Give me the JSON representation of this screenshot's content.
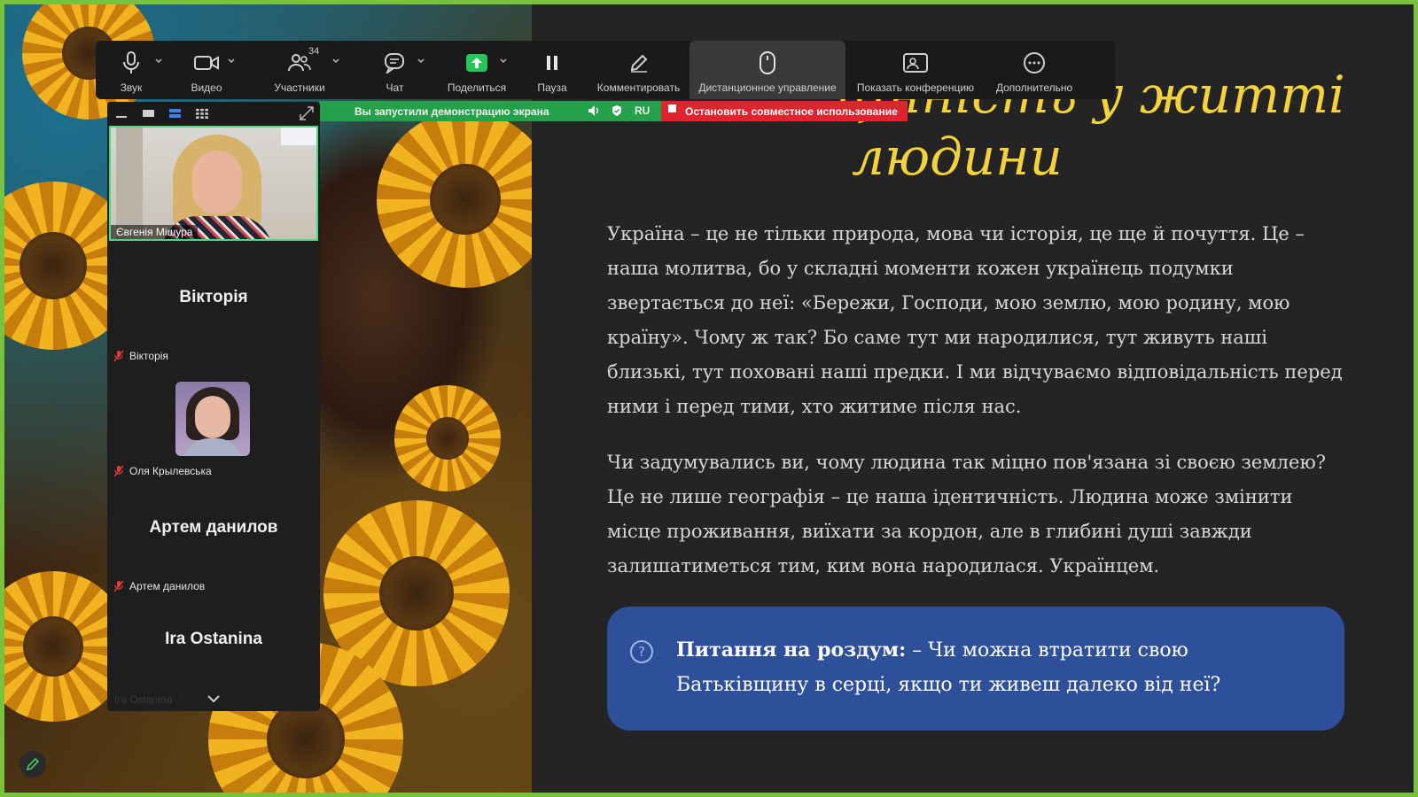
{
  "toolbar": {
    "items": [
      {
        "label": "Звук",
        "icon": "microphone-icon"
      },
      {
        "label": "Видео",
        "icon": "video-camera-icon"
      },
      {
        "label": "Участники",
        "icon": "participants-icon",
        "count": "34"
      },
      {
        "label": "Чат",
        "icon": "chat-icon"
      },
      {
        "label": "Поделиться",
        "icon": "share-screen-icon"
      },
      {
        "label": "Пауза",
        "icon": "pause-icon"
      },
      {
        "label": "Комментировать",
        "icon": "pencil-icon"
      },
      {
        "label": "Дистанционное управление",
        "icon": "mouse-icon"
      },
      {
        "label": "Показать конференцию",
        "icon": "show-meeting-icon"
      },
      {
        "label": "Дополнительно",
        "icon": "more-icon"
      }
    ],
    "share_color": "#25c55a"
  },
  "share_bar": {
    "message": "Вы запустили демонстрацию экрана",
    "language": "RU",
    "stop_label": "Остановить совместное использование"
  },
  "panel": {
    "active_video_name": "Євгенія Мішура",
    "participants": [
      {
        "display": "Вікторія",
        "label": "Вікторія"
      },
      {
        "display": "",
        "label": "Оля Крылевська"
      },
      {
        "display": "Артем данилов",
        "label": "Артем данилов"
      },
      {
        "display": "Ira Ostanina",
        "label": "Ira Ostanina"
      }
    ]
  },
  "slide": {
    "title_line1": "цінність у житті",
    "title_line2": "людини",
    "paragraph1": "Україна – це не тільки природа, мова чи історія, це ще й почуття. Це – наша молитва, бо у складні моменти кожен українець подумки звертається до неї: «Бережи, Господи, мою землю, мою родину, мою країну». Чому ж так? Бо саме тут ми народилися, тут живуть наші близькі, тут поховані наші предки. І ми відчуваємо відповідальність перед ними і перед тими, хто житиме після нас.",
    "paragraph2": "Чи задумувались ви, чому людина так міцно пов'язана зі своєю землею? Це не лише географія – це наша ідентичність. Людина може змінити місце проживання, виїхати за кордон, але в глибині душі завжди залишатиметься тим, ким вона народилася. Українцем.",
    "question_label": "Питання на роздум:",
    "question_text": " – Чи можна втратити свою Батьківщину в серці, якщо ти живеш далеко від неї?",
    "title_color": "#f3d23a",
    "box_color": "#2e4f99"
  }
}
